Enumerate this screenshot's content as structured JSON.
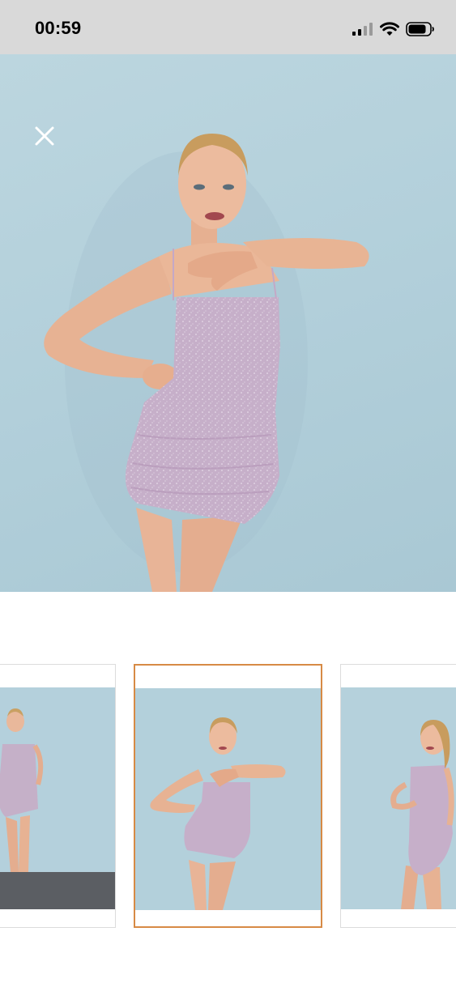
{
  "status_bar": {
    "time": "00:59",
    "icons": [
      "cellular-signal-icon",
      "wifi-icon",
      "battery-icon"
    ]
  },
  "viewer": {
    "close_icon": "close-icon",
    "photo": "product-photo-model-sparkly-lilac-mini-dress",
    "background_color": "#b3d0db"
  },
  "thumbnails": [
    {
      "photo": "model-front-pose-partial",
      "selected": false
    },
    {
      "photo": "model-hand-on-hip-pose",
      "selected": true
    },
    {
      "photo": "model-side-pose-back-detail",
      "selected": false
    }
  ],
  "colors": {
    "selected_border": "#d78a45",
    "dress": "#c9b2cc"
  }
}
